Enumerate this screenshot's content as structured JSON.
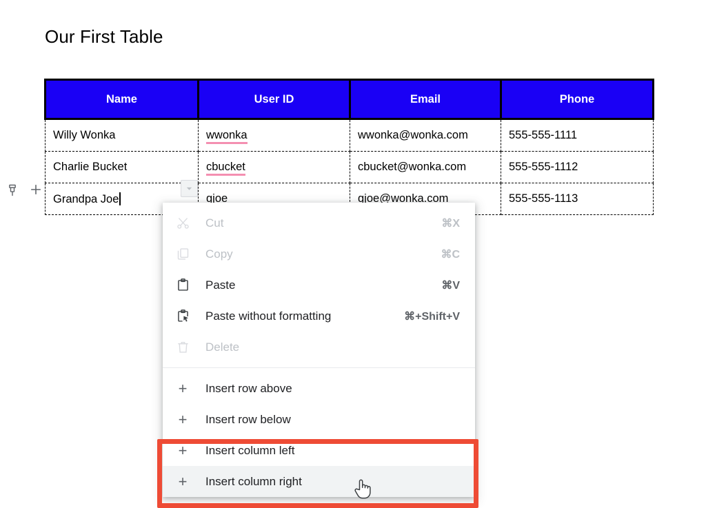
{
  "document": {
    "title": "Our First Table"
  },
  "gutter": {
    "pin_icon": "pin-icon",
    "add_icon": "plus-icon"
  },
  "table": {
    "columns": [
      "Name",
      "User ID",
      "Email",
      "Phone"
    ],
    "header_background": "#1A00F5",
    "header_text_color": "#FFFFFF",
    "border_style": "dashed-black",
    "rows": [
      {
        "name": "Willy Wonka",
        "user_id": "wwonka",
        "user_id_misspelled": true,
        "email": "wwonka@wonka.com",
        "phone": "555-555-1111"
      },
      {
        "name": "Charlie Bucket",
        "user_id": "cbucket",
        "user_id_misspelled": true,
        "email": "cbucket@wonka.com",
        "phone": "555-555-1112"
      },
      {
        "name": "Grandpa Joe",
        "user_id": "gjoe",
        "user_id_misspelled": false,
        "email": "gjoe@wonka.com",
        "phone": "555-555-1113",
        "has_caret": true,
        "active": true
      }
    ],
    "misspell_underline_color": "#F48FB1"
  },
  "cell_dropdown": {
    "icon": "chevron-down-icon"
  },
  "context_menu": {
    "groups": [
      {
        "items": [
          {
            "label": "Cut",
            "shortcut": "⌘X",
            "icon": "scissors-icon",
            "disabled": true,
            "hovered": false
          },
          {
            "label": "Copy",
            "shortcut": "⌘C",
            "icon": "copy-icon",
            "disabled": true,
            "hovered": false
          },
          {
            "label": "Paste",
            "shortcut": "⌘V",
            "icon": "clipboard-icon",
            "disabled": false,
            "hovered": false
          },
          {
            "label": "Paste without formatting",
            "shortcut": "⌘+Shift+V",
            "icon": "clipboard-cursor-icon",
            "disabled": false,
            "hovered": false
          },
          {
            "label": "Delete",
            "shortcut": "",
            "icon": "trash-icon",
            "disabled": true,
            "hovered": false
          }
        ]
      },
      {
        "items": [
          {
            "label": "Insert row above",
            "shortcut": "",
            "icon": "plus-icon",
            "disabled": false,
            "hovered": false
          },
          {
            "label": "Insert row below",
            "shortcut": "",
            "icon": "plus-icon",
            "disabled": false,
            "hovered": false
          },
          {
            "label": "Insert column left",
            "shortcut": "",
            "icon": "plus-icon",
            "disabled": false,
            "hovered": false
          },
          {
            "label": "Insert column right",
            "shortcut": "",
            "icon": "plus-icon",
            "disabled": false,
            "hovered": true
          }
        ]
      }
    ]
  },
  "annotation": {
    "highlight_color": "#EE4B35",
    "highlights_items": [
      "Insert column left",
      "Insert column right"
    ]
  },
  "cursor": {
    "type": "pointing-hand-cursor"
  }
}
